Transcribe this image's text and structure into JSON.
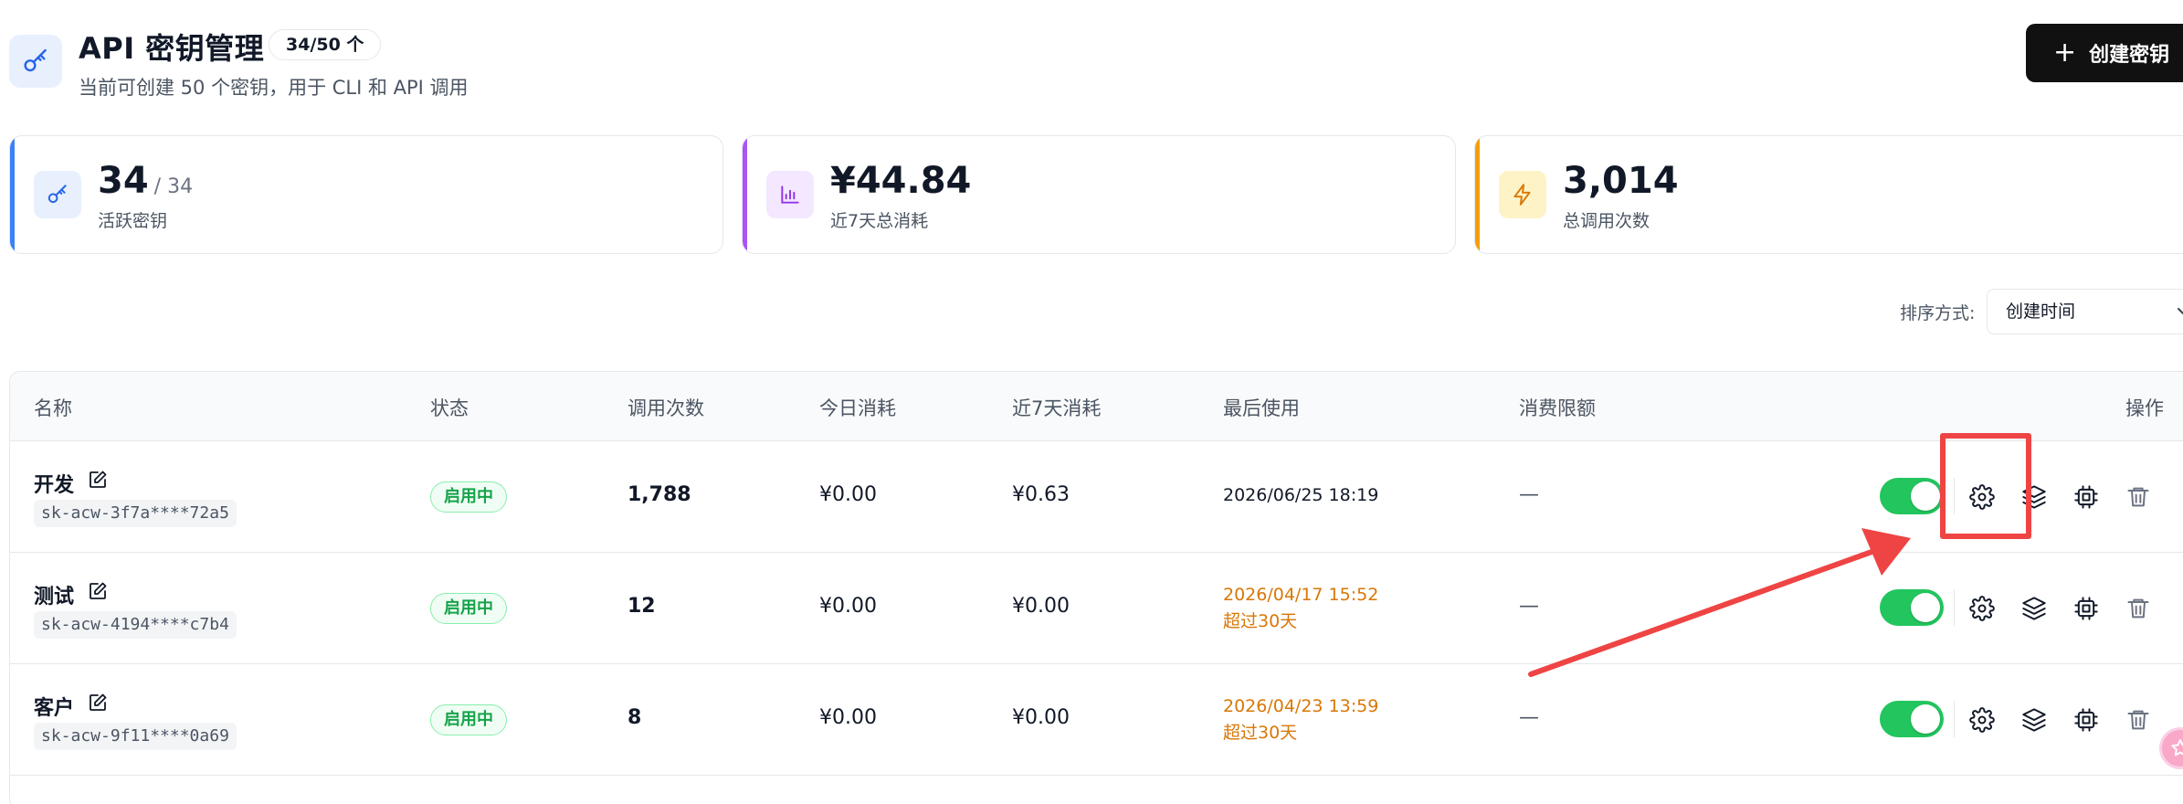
{
  "header": {
    "title": "API 密钥管理",
    "count_badge": "34/50 个",
    "subtitle": "当前可创建 50 个密钥，用于 CLI 和 API 调用",
    "create_button": "创建密钥",
    "icon": "key-icon"
  },
  "stats": [
    {
      "value": "34",
      "suffix": "/ 34",
      "label": "活跃密钥",
      "icon": "key-icon",
      "accent": "#3b82f6",
      "icon_bg": "#e8f0fd",
      "icon_color": "#2563eb"
    },
    {
      "value": "¥44.84",
      "suffix": "",
      "label": "近7天总消耗",
      "icon": "bar-chart-icon",
      "accent": "#a855f7",
      "icon_bg": "#f3e8ff",
      "icon_color": "#9333ea"
    },
    {
      "value": "3,014",
      "suffix": "",
      "label": "总调用次数",
      "icon": "lightning-icon",
      "accent": "#f59e0b",
      "icon_bg": "#fef3c7",
      "icon_color": "#d97706"
    }
  ],
  "sort": {
    "label": "排序方式:",
    "selected": "创建时间"
  },
  "table": {
    "columns": [
      "名称",
      "状态",
      "调用次数",
      "今日消耗",
      "近7天消耗",
      "最后使用",
      "消费限额",
      "操作"
    ],
    "rows": [
      {
        "name": "开发",
        "key": "sk-acw-3f7a****72a5",
        "status": "启用中",
        "calls": "1,788",
        "today": "¥0.00",
        "week": "¥0.63",
        "last_used": "2026/06/25 18:19",
        "stale": "",
        "limit": "—",
        "enabled": true
      },
      {
        "name": "测试",
        "key": "sk-acw-4194****c7b4",
        "status": "启用中",
        "calls": "12",
        "today": "¥0.00",
        "week": "¥0.00",
        "last_used": "2026/04/17 15:52",
        "stale": "超过30天",
        "limit": "—",
        "enabled": true
      },
      {
        "name": "客户",
        "key": "sk-acw-9f11****0a69",
        "status": "启用中",
        "calls": "8",
        "today": "¥0.00",
        "week": "¥0.00",
        "last_used": "2026/04/23 13:59",
        "stale": "超过30天",
        "limit": "—",
        "enabled": true
      }
    ]
  },
  "colors": {
    "highlight": "#ef4444",
    "status_green": "#16a34a",
    "stale_orange": "#d97706"
  }
}
